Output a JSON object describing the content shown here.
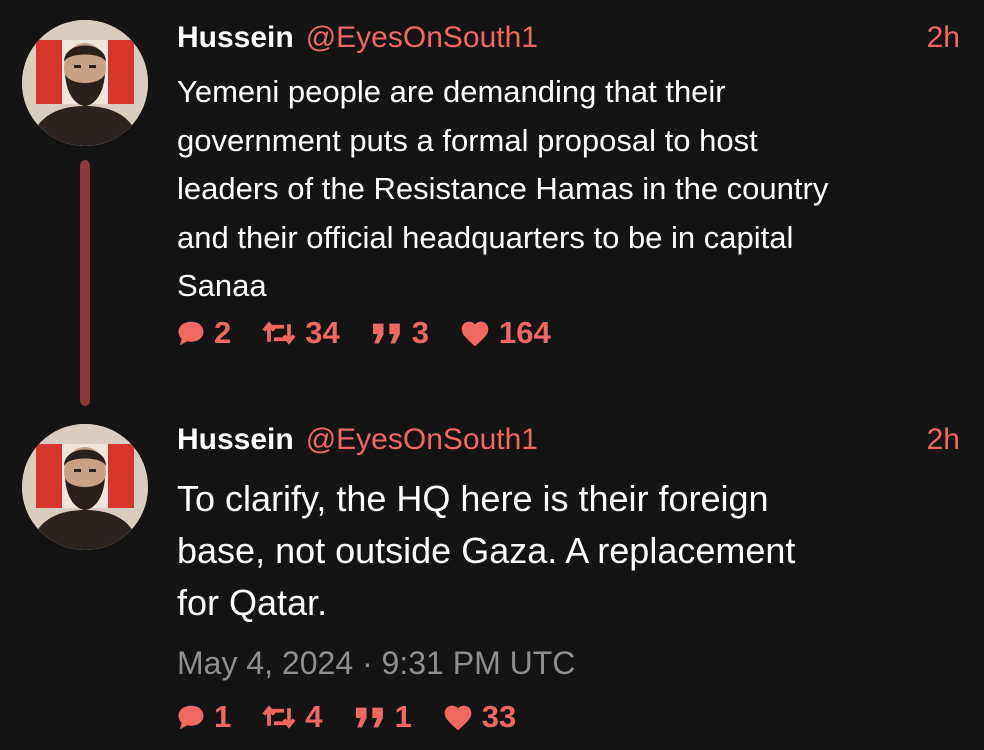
{
  "colors": {
    "background": "#141414",
    "accent": "#f0685f",
    "thread_line": "#8a3a37",
    "secondary_text": "#8e8e93",
    "primary_text": "#ffffff"
  },
  "tweets": [
    {
      "display_name": "Hussein",
      "handle": "@EyesOnSouth1",
      "time": "2h",
      "text": "Yemeni people are demanding that their\ngovernment puts a formal proposal to host\nleaders of the Resistance Hamas in the country\nand their official headquarters to be in capital\nSanaa",
      "stats": {
        "replies": "2",
        "retweets": "34",
        "quotes": "3",
        "likes": "164"
      },
      "icons": [
        "reply-icon",
        "retweet-icon",
        "quote-icon",
        "like-icon"
      ]
    },
    {
      "display_name": "Hussein",
      "handle": "@EyesOnSouth1",
      "time": "2h",
      "text": "To clarify, the HQ here is their foreign\nbase, not outside Gaza. A replacement\nfor Qatar.",
      "date": "May 4, 2024 · 9:31 PM UTC",
      "stats": {
        "replies": "1",
        "retweets": "4",
        "quotes": "1",
        "likes": "33"
      },
      "icons": [
        "reply-icon",
        "retweet-icon",
        "quote-icon",
        "like-icon"
      ]
    }
  ]
}
